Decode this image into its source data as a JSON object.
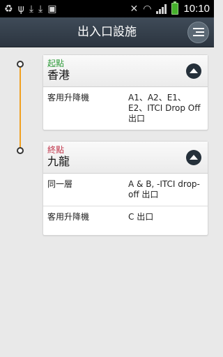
{
  "status_bar": {
    "time": "10:10",
    "icons": [
      "recycle-icon",
      "usb-icon",
      "download-icon",
      "download-icon",
      "image-icon",
      "mute-icon",
      "wifi-icon",
      "signal-icon",
      "battery-charging-icon"
    ]
  },
  "header": {
    "title": "出入口設施",
    "menu_icon": "list-icon"
  },
  "colors": {
    "header_bg": "#333d48",
    "timeline": "#f0a020",
    "start_label": "#2f9a3a",
    "end_label": "#c0354a"
  },
  "start": {
    "label": "起點",
    "place": "香港",
    "rows": [
      {
        "label": "客用升降機",
        "value": "A1、A2、E1、E2、ITCI Drop Off 出口"
      }
    ]
  },
  "end": {
    "label": "終點",
    "place": "九龍",
    "rows": [
      {
        "label": "同一層",
        "value": "A & B, -ITCI drop-off 出口"
      },
      {
        "label": "客用升降機",
        "value": "C 出口"
      }
    ]
  }
}
